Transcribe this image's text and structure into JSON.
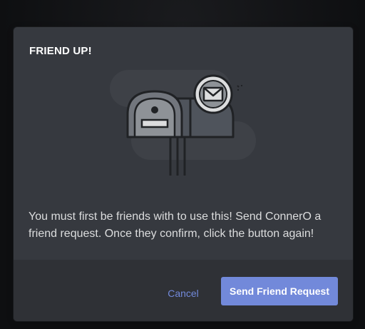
{
  "modal": {
    "title": "FRIEND UP!",
    "message": "You must first be friends with to use this! Send ConnerO a friend request. Once they confirm, click the button again!",
    "illustration_icon": "mailbox-envelope-illustration"
  },
  "footer": {
    "cancel_label": "Cancel",
    "send_label": "Send Friend Request"
  },
  "colors": {
    "accent": "#7289da",
    "modal_bg": "#36393f",
    "footer_bg": "#2f3136",
    "text": "#dcddde"
  }
}
